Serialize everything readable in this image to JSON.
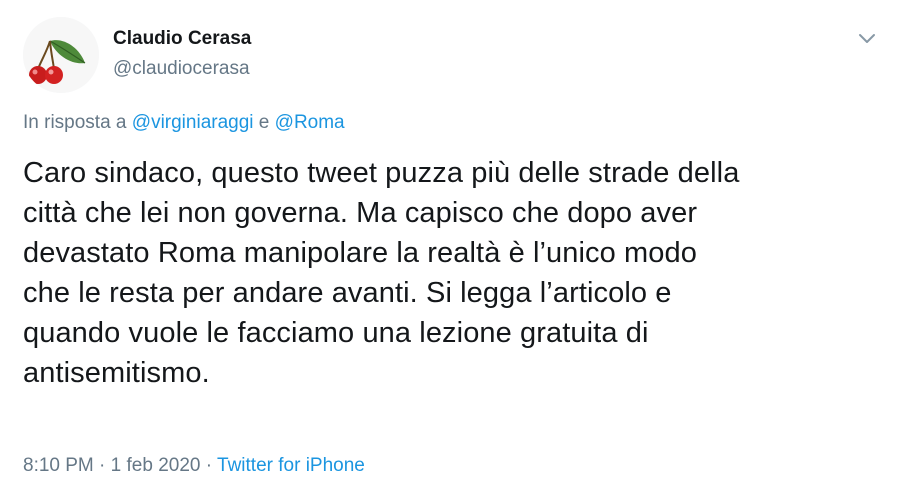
{
  "author": {
    "display_name": "Claudio Cerasa",
    "handle": "@claudiocerasa",
    "avatar_icon": "cherries-icon"
  },
  "more_icon": "chevron-down-icon",
  "reply": {
    "prefix": "In risposta a",
    "mention_1": "@virginiaraggi",
    "conjunction": "e",
    "mention_2": "@Roma"
  },
  "tweet": {
    "lines": [
      "Caro sindaco, questo tweet puzza più delle strade della",
      "città che lei non governa. Ma capisco che dopo aver",
      "devastato Roma manipolare la realtà è l’unico modo",
      "che le resta per andare avanti. Si legga l’articolo e",
      "quando vuole le facciamo una lezione gratuita di",
      "antisemitismo."
    ]
  },
  "meta": {
    "time": "8:10 PM",
    "separator": "·",
    "date": "1 feb 2020",
    "source": "Twitter for iPhone"
  },
  "colors": {
    "link": "#1b95e0",
    "secondary_text": "#657786",
    "primary_text": "#14171a"
  }
}
